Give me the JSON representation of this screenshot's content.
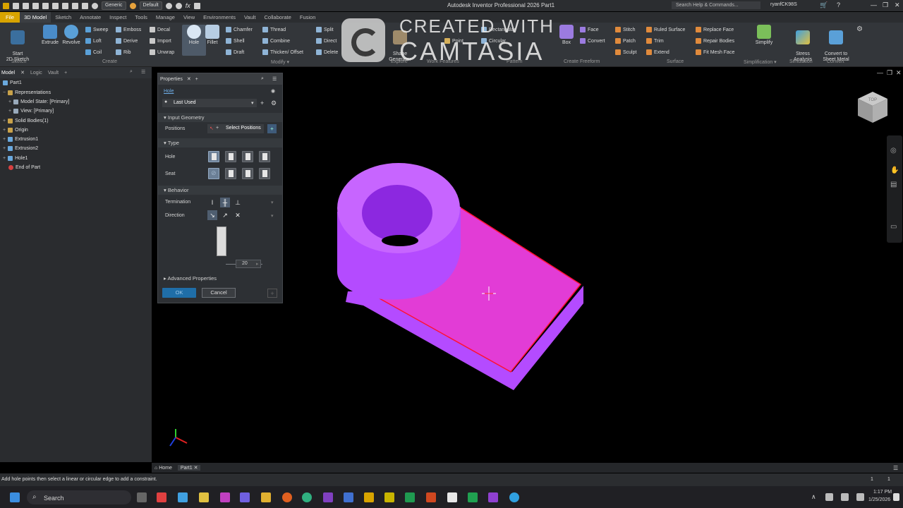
{
  "title_bar": {
    "app_title": "Autodesk Inventor Professional 2026   Part1",
    "appearance_dropdown": "Generic",
    "material_dropdown": "Default",
    "fx_label": "fx",
    "search_placeholder": "Search Help & Commands...",
    "user_name": "ryanfCK98S"
  },
  "menu_tabs": [
    "File",
    "3D Model",
    "Sketch",
    "Annotate",
    "Inspect",
    "Tools",
    "Manage",
    "View",
    "Environments",
    "Vault",
    "Collaborate",
    "Fusion"
  ],
  "active_tab": "3D Model",
  "ribbon": {
    "start_sketch": "Start\n2D Sketch",
    "extrude": "Extrude",
    "revolve": "Revolve",
    "sweep": "Sweep",
    "emboss": "Emboss",
    "decal": "Decal",
    "loft": "Loft",
    "derive": "Derive",
    "import": "Import",
    "coil": "Coil",
    "rib": "Rib",
    "unwrap": "Unwrap",
    "hole": "Hole",
    "fillet": "Fillet",
    "chamfer": "Chamfer",
    "thread": "Thread",
    "split": "Split",
    "shell": "Shell",
    "combine": "Combine",
    "direct": "Direct",
    "draft": "Draft",
    "thicken": "Thicken/ Offset",
    "delete": "Delete",
    "shape_generator": "Shape\nGenerator",
    "point": "Point",
    "circular": "Circular",
    "rectangular": "Rectangular",
    "box": "Box",
    "face": "Face",
    "convert": "Convert",
    "stitch": "Stitch",
    "ruled_surface": "Ruled Surface",
    "replace_face": "Replace Face",
    "patch": "Patch",
    "trim": "Trim",
    "repair_bodies": "Repair Bodies",
    "sculpt": "Sculpt",
    "extend": "Extend",
    "fit_mesh_face": "Fit Mesh Face",
    "simplify": "Simplify",
    "stress_analysis": "Stress\nAnalysis",
    "convert_sheet_metal": "Convert to\nSheet Metal",
    "groups": {
      "sketch": "Sketch",
      "create": "Create",
      "modify": "Modify ▾",
      "explore": "Explore",
      "work_features": "Work Features",
      "pattern": "Pattern",
      "create_freeform": "Create Freeform",
      "surface": "Surface",
      "simplification": "Simplification ▾",
      "simulation": "Simulation",
      "convert": "Convert"
    }
  },
  "watermark": {
    "line1": "CREATED WITH",
    "line2": "CAMTASIA"
  },
  "browser": {
    "tabs": [
      "Model",
      "Logic",
      "Vault"
    ],
    "tree": [
      "Part1",
      "Representations",
      "Model State: [Primary]",
      "View: [Primary]",
      "Solid Bodies(1)",
      "Origin",
      "Extrusion1",
      "Extrusion2",
      "Hole1",
      "End of Part"
    ]
  },
  "properties": {
    "panel_title": "Properties",
    "feature_name": "Hole",
    "preset": "Last Used",
    "input_geometry": "Input Geometry",
    "positions_label": "Positions",
    "select_positions": "Select Positions",
    "type_section": "Type",
    "hole_label": "Hole",
    "seat_label": "Seat",
    "behavior_section": "Behavior",
    "termination_label": "Termination",
    "direction_label": "Direction",
    "dimension_value": "20",
    "advanced_section": "Advanced Properties",
    "ok_label": "OK",
    "cancel_label": "Cancel"
  },
  "viewcube": {
    "face_label": "TOP"
  },
  "doc_tabs": {
    "home": "Home",
    "part": "Part1"
  },
  "status_bar": {
    "message": "Add hole points then select a linear or circular edge to add a constraint.",
    "count1": "1",
    "count2": "1"
  },
  "taskbar": {
    "search_label": "Search",
    "time": "1:17 PM",
    "date": "1/25/2026"
  },
  "colors": {
    "model_side": "#b44bff",
    "model_top": "#e23cd6",
    "selected_edge": "#ff1133",
    "accent_file_tab": "#d8a400"
  }
}
